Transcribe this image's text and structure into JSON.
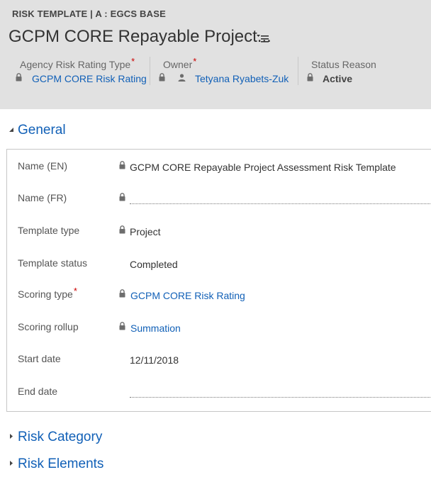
{
  "header": {
    "entity_title": "RISK TEMPLATE | A : EGCS BASE",
    "record_title": "GCPM CORE Repayable Project...",
    "fields": [
      {
        "label": "Agency Risk Rating Type",
        "required": "*",
        "value": "GCPM CORE Risk Rating"
      },
      {
        "label": "Owner",
        "required": "*",
        "value": "Tetyana Ryabets-Zuk"
      },
      {
        "label": "Status Reason",
        "value": "Active"
      }
    ]
  },
  "sections": {
    "general": "General",
    "risk_category": "Risk Category",
    "risk_elements": "Risk Elements"
  },
  "form": {
    "name_en": {
      "label": "Name (EN)",
      "value": "GCPM CORE Repayable Project Assessment Risk Template"
    },
    "name_fr": {
      "label": "Name (FR)",
      "value": ""
    },
    "template_type": {
      "label": "Template type",
      "value": "Project"
    },
    "template_status": {
      "label": "Template status",
      "value": "Completed"
    },
    "scoring_type": {
      "label": "Scoring type",
      "required": "*",
      "value": "GCPM CORE Risk Rating"
    },
    "scoring_rollup": {
      "label": "Scoring rollup",
      "value": "Summation"
    },
    "start_date": {
      "label": "Start date",
      "value": "12/11/2018"
    },
    "end_date": {
      "label": "End date",
      "value": ""
    }
  },
  "colors": {
    "link": "#1160b7",
    "header_bg": "#e1e1e1",
    "required": "#cc0000"
  }
}
